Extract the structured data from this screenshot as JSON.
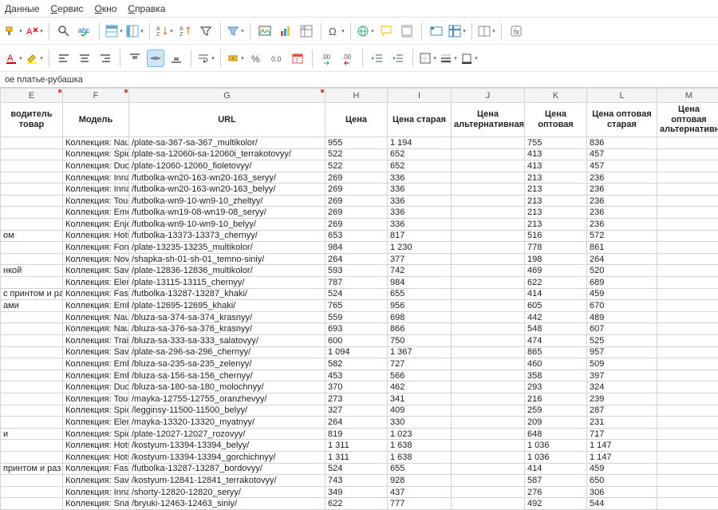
{
  "menu": {
    "items": [
      "Данные",
      "Сервис",
      "Окно",
      "Справка"
    ]
  },
  "formula_bar": "ое платье-рубашка",
  "columns": [
    {
      "id": "E",
      "label": "водитель товар"
    },
    {
      "id": "F",
      "label": "Модель"
    },
    {
      "id": "G",
      "label": "URL"
    },
    {
      "id": "H",
      "label": "Цена"
    },
    {
      "id": "I",
      "label": "Цена старая"
    },
    {
      "id": "J",
      "label": "Цена альтернативная"
    },
    {
      "id": "K",
      "label": "Цена оптовая"
    },
    {
      "id": "L",
      "label": "Цена оптовая старая"
    },
    {
      "id": "M",
      "label": "Цена оптовая альтернативная"
    }
  ],
  "rows": [
    {
      "e": "",
      "f": "Коллекция: Naug",
      "g": "/plate-sa-367-sa-367_multikolor/",
      "h": "955",
      "i": "1 194",
      "j": "",
      "k": "755",
      "l": "836",
      "m": ""
    },
    {
      "e": "",
      "f": "Коллекция: Spicy",
      "g": "/plate-sa-12060i-sa-12060i_terrakotovyy/",
      "h": "522",
      "i": "652",
      "j": "",
      "k": "413",
      "l": "457",
      "m": ""
    },
    {
      "e": "",
      "f": "Коллекция: Duch",
      "g": "/plate-12060-12060_fioletovyy/",
      "h": "522",
      "i": "652",
      "j": "",
      "k": "413",
      "l": "457",
      "m": ""
    },
    {
      "e": "",
      "f": "Коллекция: Innat",
      "g": "/futbolka-wn20-163-wn20-163_seryy/",
      "h": "269",
      "i": "336",
      "j": "",
      "k": "213",
      "l": "236",
      "m": ""
    },
    {
      "e": "",
      "f": "Коллекция: Innat",
      "g": "/futbolka-wn20-163-wn20-163_belyy/",
      "h": "269",
      "i": "336",
      "j": "",
      "k": "213",
      "l": "236",
      "m": ""
    },
    {
      "e": "",
      "f": "Коллекция: Touc",
      "g": "/futbolka-wn9-10-wn9-10_zheltyy/",
      "h": "269",
      "i": "336",
      "j": "",
      "k": "213",
      "l": "236",
      "m": ""
    },
    {
      "e": "",
      "f": "Коллекция: Emer",
      "g": "/futbolka-wn19-08-wn19-08_seryy/",
      "h": "269",
      "i": "336",
      "j": "",
      "k": "213",
      "l": "236",
      "m": ""
    },
    {
      "e": "",
      "f": "Коллекция: Enjoy",
      "g": "/futbolka-wn9-10-wn9-10_belyy/",
      "h": "269",
      "i": "336",
      "j": "",
      "k": "213",
      "l": "236",
      "m": ""
    },
    {
      "e": "ом",
      "f": "Коллекция: Hots",
      "g": "/futbolka-13373-13373_chernyy/",
      "h": "653",
      "i": "817",
      "j": "",
      "k": "516",
      "l": "572",
      "m": ""
    },
    {
      "e": "",
      "f": "Коллекция: Fond",
      "g": "/plate-13235-13235_multikolor/",
      "h": "984",
      "i": "1 230",
      "j": "",
      "k": "778",
      "l": "861",
      "m": ""
    },
    {
      "e": "",
      "f": "Коллекция: Nove",
      "g": "/shapka-sh-01-sh-01_temno-siniy/",
      "h": "264",
      "i": "377",
      "j": "",
      "k": "198",
      "l": "264",
      "m": ""
    },
    {
      "e": "нкой",
      "f": "Коллекция: Savo",
      "g": "/plate-12836-12836_multikolor/",
      "h": "593",
      "i": "742",
      "j": "",
      "k": "469",
      "l": "520",
      "m": ""
    },
    {
      "e": "",
      "f": "Коллекция: Elem",
      "g": "/plate-13115-13115_chernyy/",
      "h": "787",
      "i": "984",
      "j": "",
      "k": "622",
      "l": "689",
      "m": ""
    },
    {
      "e": "с принтом и ра",
      "f": "Коллекция: Fash",
      "g": "/futbolka-13287-13287_khaki/",
      "h": "524",
      "i": "655",
      "j": "",
      "k": "414",
      "l": "459",
      "m": ""
    },
    {
      "e": "ами",
      "f": "Коллекция: Embr",
      "g": "/plate-12695-12695_khaki/",
      "h": "765",
      "i": "956",
      "j": "",
      "k": "605",
      "l": "670",
      "m": ""
    },
    {
      "e": "",
      "f": "Коллекция: Naug",
      "g": "/bluza-sa-374-sa-374_krasnyy/",
      "h": "559",
      "i": "698",
      "j": "",
      "k": "442",
      "l": "489",
      "m": ""
    },
    {
      "e": "",
      "f": "Коллекция: Naug",
      "g": "/bluza-sa-376-sa-376_krasnyy/",
      "h": "693",
      "i": "866",
      "j": "",
      "k": "548",
      "l": "607",
      "m": ""
    },
    {
      "e": "",
      "f": "Коллекция: Trail",
      "g": "/bluza-sa-333-sa-333_salatovyy/",
      "h": "600",
      "i": "750",
      "j": "",
      "k": "474",
      "l": "525",
      "m": ""
    },
    {
      "e": "",
      "f": "Коллекция: Savo",
      "g": "/plate-sa-296-sa-296_chernyy/",
      "h": "1 094",
      "i": "1 367",
      "j": "",
      "k": "865",
      "l": "957",
      "m": ""
    },
    {
      "e": "",
      "f": "Коллекция: Embr",
      "g": "/bluza-sa-235-sa-235_zelenyy/",
      "h": "582",
      "i": "727",
      "j": "",
      "k": "460",
      "l": "509",
      "m": ""
    },
    {
      "e": "",
      "f": "Коллекция: Embr",
      "g": "/bluza-sa-156-sa-156_chernyy/",
      "h": "453",
      "i": "566",
      "j": "",
      "k": "358",
      "l": "397",
      "m": ""
    },
    {
      "e": "",
      "f": "Коллекция: Duch",
      "g": "/bluza-sa-180-sa-180_molochnyy/",
      "h": "370",
      "i": "462",
      "j": "",
      "k": "293",
      "l": "324",
      "m": ""
    },
    {
      "e": "",
      "f": "Коллекция: Touc",
      "g": "/mayka-12755-12755_oranzhevyy/",
      "h": "273",
      "i": "341",
      "j": "",
      "k": "216",
      "l": "239",
      "m": ""
    },
    {
      "e": "",
      "f": "Коллекция: Spicy",
      "g": "/legginsy-11500-11500_belyy/",
      "h": "327",
      "i": "409",
      "j": "",
      "k": "259",
      "l": "287",
      "m": ""
    },
    {
      "e": "",
      "f": "Коллекция: Elem",
      "g": "/mayka-13320-13320_myatnyy/",
      "h": "264",
      "i": "330",
      "j": "",
      "k": "209",
      "l": "231",
      "m": ""
    },
    {
      "e": "и",
      "f": "Коллекция: Spicy",
      "g": "/plate-12027-12027_rozovyy/",
      "h": "819",
      "i": "1 023",
      "j": "",
      "k": "648",
      "l": "717",
      "m": ""
    },
    {
      "e": "",
      "f": "Коллекция: Hots",
      "g": "/kostyum-13394-13394_belyy/",
      "h": "1 311",
      "i": "1 638",
      "j": "",
      "k": "1 036",
      "l": "1 147",
      "m": ""
    },
    {
      "e": "",
      "f": "Коллекция: Hots",
      "g": "/kostyum-13394-13394_gorchichnyy/",
      "h": "1 311",
      "i": "1 638",
      "j": "",
      "k": "1 036",
      "l": "1 147",
      "m": ""
    },
    {
      "e": "принтом и раз",
      "f": "Коллекция: Fash",
      "g": "/futbolka-13287-13287_bordovyy/",
      "h": "524",
      "i": "655",
      "j": "",
      "k": "414",
      "l": "459",
      "m": ""
    },
    {
      "e": "",
      "f": "Коллекция: Savo",
      "g": "/kostyum-12841-12841_terrakotovyy/",
      "h": "743",
      "i": "928",
      "j": "",
      "k": "587",
      "l": "650",
      "m": ""
    },
    {
      "e": "",
      "f": "Коллекция: Innat",
      "g": "/shorty-12820-12820_seryy/",
      "h": "349",
      "i": "437",
      "j": "",
      "k": "276",
      "l": "306",
      "m": ""
    },
    {
      "e": "",
      "f": "Коллекция: Snaz",
      "g": "/bryuki-12463-12463_siniy/",
      "h": "622",
      "i": "777",
      "j": "",
      "k": "492",
      "l": "544",
      "m": ""
    }
  ]
}
